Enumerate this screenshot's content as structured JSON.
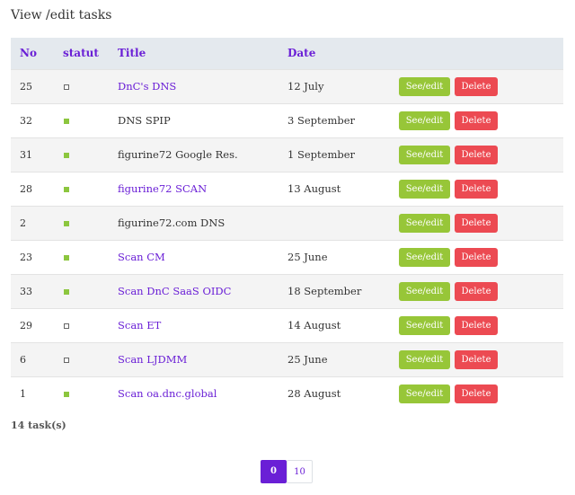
{
  "page": {
    "title": "View /edit tasks"
  },
  "table": {
    "headers": {
      "no": "No",
      "status": "statut",
      "title": "Title",
      "date": "Date"
    },
    "rows": [
      {
        "no": "25",
        "status": "open",
        "title": "DnC's DNS",
        "linked": true,
        "date": "12 July"
      },
      {
        "no": "32",
        "status": "done",
        "title": "DNS SPIP",
        "linked": false,
        "date": "3 September"
      },
      {
        "no": "31",
        "status": "done",
        "title": "figurine72 Google Res.",
        "linked": false,
        "date": "1 September"
      },
      {
        "no": "28",
        "status": "done",
        "title": "figurine72 SCAN",
        "linked": true,
        "date": "13 August"
      },
      {
        "no": "2",
        "status": "done",
        "title": "figurine72.com DNS",
        "linked": false,
        "date": ""
      },
      {
        "no": "23",
        "status": "done",
        "title": "Scan CM",
        "linked": true,
        "date": "25 June"
      },
      {
        "no": "33",
        "status": "done",
        "title": "Scan DnC SaaS OIDC",
        "linked": true,
        "date": "18 September"
      },
      {
        "no": "29",
        "status": "open",
        "title": "Scan ET",
        "linked": true,
        "date": "14 August"
      },
      {
        "no": "6",
        "status": "open",
        "title": "Scan LJDMM",
        "linked": true,
        "date": "25 June"
      },
      {
        "no": "1",
        "status": "done",
        "title": "Scan oa.dnc.global",
        "linked": true,
        "date": "28 August"
      }
    ],
    "see_edit_label": "See/edit",
    "delete_label": "Delete"
  },
  "summary": {
    "count_label": "14 task(s)"
  },
  "pagination": {
    "pages": [
      "0",
      "10"
    ],
    "active": "0"
  },
  "colors": {
    "accent": "#6a1fd6",
    "see_edit": "#97c638",
    "delete": "#ec4a52",
    "status_done": "#8cc63e"
  }
}
